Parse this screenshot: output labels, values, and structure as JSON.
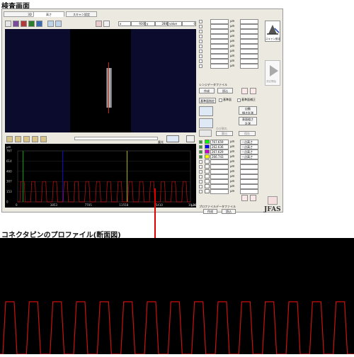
{
  "captions": {
    "top": "検査画面",
    "bottom": "コネクタピンのプロファイル(断面図)"
  },
  "tabs": [
    "3D",
    "高さ",
    "スキャン設定"
  ],
  "coord_bar": {
    "x_label": "x",
    "x_value": "930",
    "y_label": "y",
    "y_value": "288",
    "value_label": "value",
    "value": "0"
  },
  "profile_panel": {
    "unit": "μm",
    "y_ticks": [
      "767",
      "614",
      "460",
      "307",
      "153",
      "0"
    ],
    "x_ticks": [
      "0",
      "3853",
      "7705",
      "11558",
      "15410",
      "19,263"
    ],
    "x_unit": "μm",
    "dropdown_label": "露光"
  },
  "right_list": {
    "unit": "μm",
    "lens_label": "レンジデータファイル",
    "create_label": "作成",
    "read_label": "読込",
    "scene_label": "基準面指定",
    "scene_check": "基準面",
    "scene_check2": "基準面補正",
    "auto_label": "自動\n傾き計測",
    "surface_label": "表面粗さ\n計測",
    "gap_label": "ひび割れ",
    "gap_measure": "算出",
    "gap_save": "保存",
    "measurements": [
      {
        "color": "#00ff00",
        "value": "767.659",
        "label": "一点高さ"
      },
      {
        "color": "#0000ff",
        "value": "262.636",
        "label": "一点高さ"
      },
      {
        "color": "#cc00cc",
        "value": "267.629",
        "label": "一点高さ"
      },
      {
        "color": "#ffff00",
        "value": "266.743",
        "label": "一点高さ"
      }
    ],
    "profile_file_label": "プロファイルデータファイル",
    "profile_create": "作成",
    "profile_read": "読込"
  },
  "side_buttons": {
    "scan_settings": "スキャン設定",
    "start": "測定開始"
  },
  "logo": "JFAS",
  "chart_data": {
    "type": "line",
    "title": "",
    "xlabel": "",
    "ylabel": "",
    "xlim": [
      0,
      19263
    ],
    "ylim": [
      0,
      767
    ],
    "series": [
      {
        "color": "#cc1111",
        "pins": 16,
        "low": 0,
        "high": 307
      }
    ],
    "markers": [
      {
        "x": 600,
        "color": "#00cc00"
      },
      {
        "x": 5000,
        "color": "#1111ff"
      },
      {
        "x": 12200,
        "color": "#dddd00"
      }
    ]
  },
  "zoom_chart": {
    "pins": 15,
    "color": "#cc1111"
  }
}
